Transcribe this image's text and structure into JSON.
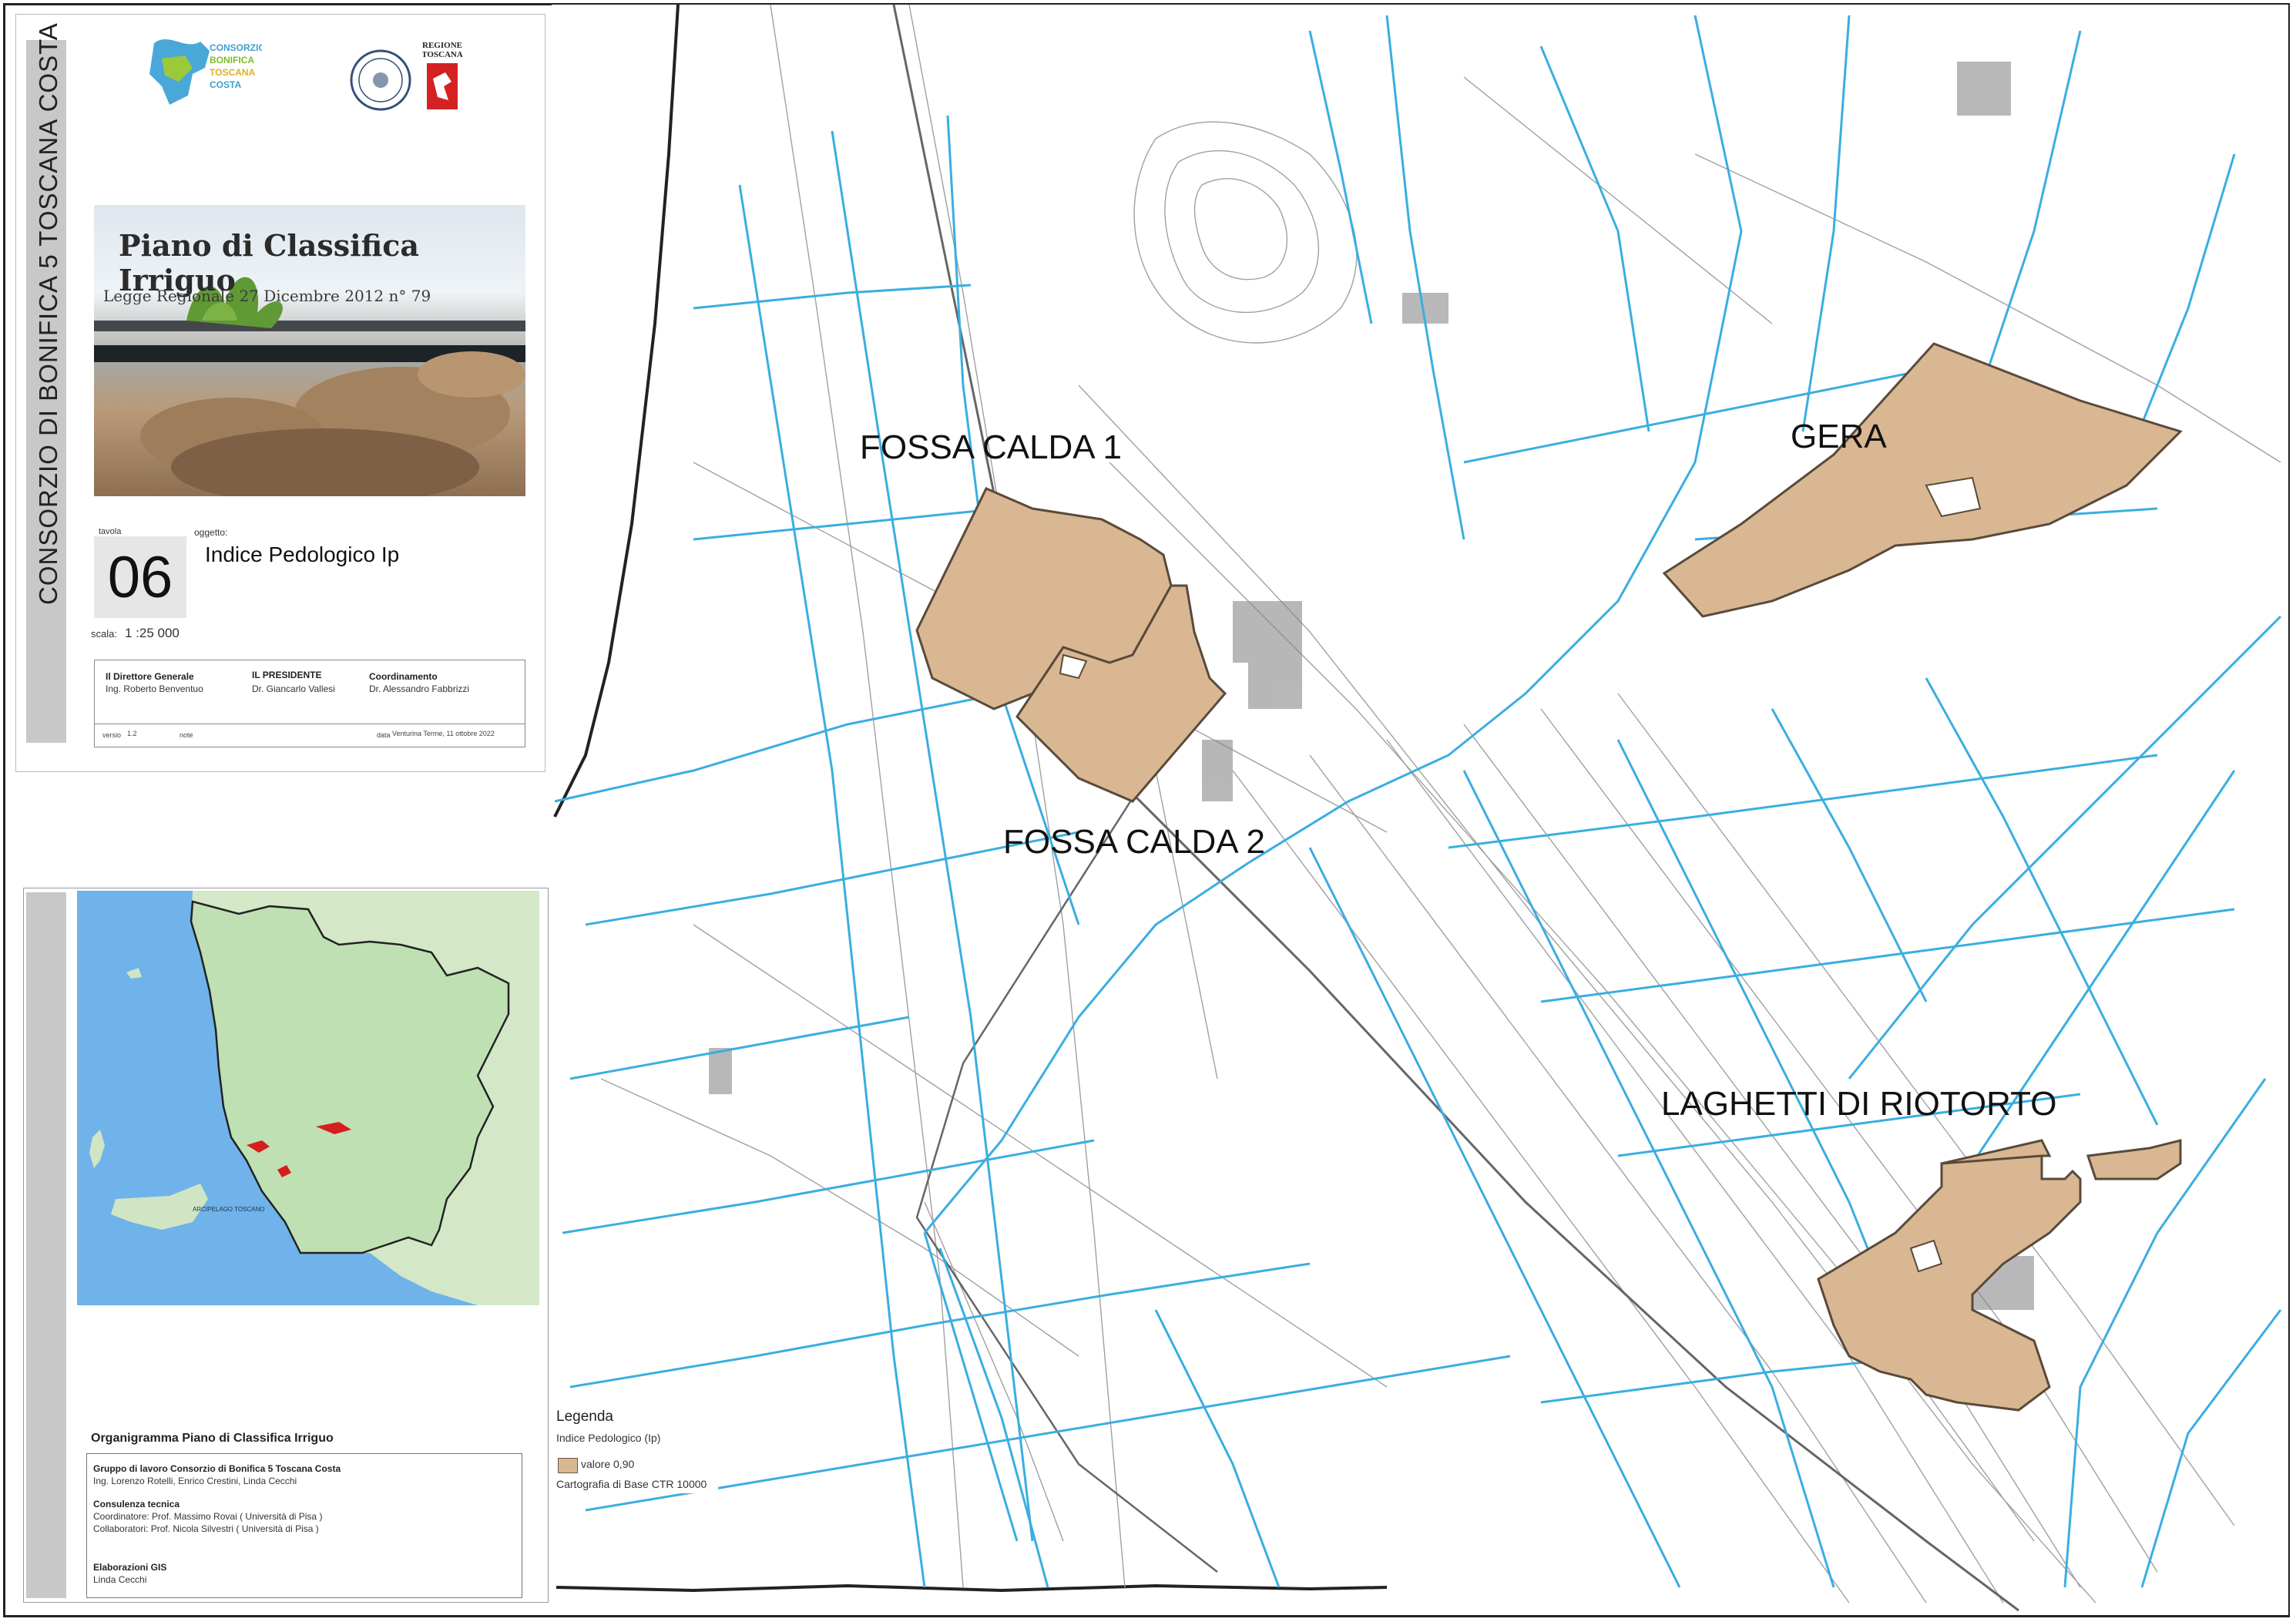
{
  "title_block": {
    "vertical_title": "CONSORZIO DI BONIFICA 5 TOSCANA COSTA",
    "logo_text": [
      "CONSORZIO",
      "BONIFICA",
      "TOSCANA",
      "COSTA"
    ],
    "region_logo_text": [
      "REGIONE",
      "TOSCANA"
    ],
    "photo_title": "Piano di Classifica Irriguo",
    "photo_subtitle": "Legge Regionale 27 Dicembre 2012 n° 79",
    "tavola_label": "tavola",
    "tavola_number": "06",
    "oggetto_label": "oggetto:",
    "oggetto": "Indice Pedologico  Ip",
    "scala_label": "scala:",
    "scala": "1 :25 000",
    "signatures": [
      {
        "role": "Il Direttore Generale",
        "name": "Ing. Roberto Benventuo"
      },
      {
        "role": "IL PRESIDENTE",
        "name": "Dr. Giancarlo Vallesi"
      },
      {
        "role": "Coordinamento",
        "name": "Dr. Alessandro Fabbrizzi"
      }
    ],
    "version_label": "versio",
    "version": "1.2",
    "note_label": "note",
    "data_label": "data",
    "data": "Venturina Terme, 11 ottobre 2022"
  },
  "organigramma": {
    "title": "Organigramma Piano di Classifica Irriguo",
    "sections": [
      {
        "heading": "Gruppo di lavoro Consorzio di Bonifica 5 Toscana Costa",
        "lines": [
          "Ing. Lorenzo Rotelli, Enrico Crestini, Linda Cecchi"
        ]
      },
      {
        "heading": "Consulenza tecnica",
        "lines": [
          "Coordinatore: Prof. Massimo Rovai ( Università di Pisa )",
          "Collaboratori: Prof. Nicola Silvestri ( Università di Pisa )"
        ]
      },
      {
        "heading": "Elaborazioni GIS",
        "lines": [
          "Linda Cecchi"
        ]
      }
    ]
  },
  "map": {
    "area_labels": [
      "FOSSA CALDA 1",
      "FOSSA CALDA 2",
      "GERA",
      "LAGHETTI DI RIOTORTO"
    ],
    "inset_sea_label": "ARCIPELAGO TOSCANO",
    "colors": {
      "area_fill": "#d9b793",
      "area_stroke": "#5a4a3a",
      "water": "#3aaee0",
      "base_lines": "#9a9a9a",
      "inset_sea": "#6fb3ea",
      "inset_land": "#cfe5c4",
      "inset_highlight": "#d61e1e"
    }
  },
  "legend": {
    "title": "Legenda",
    "subtitle": "Indice Pedologico (Ip)",
    "entry": "valore 0,90",
    "base": "Cartografia di Base CTR 10000"
  }
}
